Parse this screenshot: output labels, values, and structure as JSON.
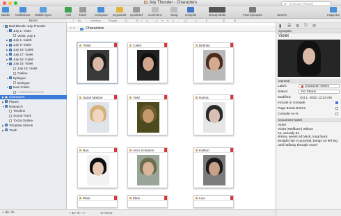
{
  "window": {
    "title": "July Thunder - Characters"
  },
  "toolbar": {
    "items": [
      {
        "label": "Binder",
        "color": "#4a8fd8"
      },
      {
        "label": "Collections",
        "color": "#4a8fd8"
      },
      {
        "label": "Mobile Sync",
        "color": "#5aa0e0"
      },
      {
        "label": "Add",
        "color": "#3fa34d"
      },
      {
        "label": "Trash",
        "color": "#9a9a9a"
      },
      {
        "label": "Compose",
        "color": "#4a8fd8"
      },
      {
        "label": "Keywords",
        "color": "#e1b23c"
      },
      {
        "label": "QuickRef",
        "color": "#9a9a9a"
      },
      {
        "label": "Comment",
        "color": "#bdbdbd"
      },
      {
        "label": "Wrap",
        "color": "#bdbdbd"
      },
      {
        "label": "Compile",
        "color": "#3f78c9"
      },
      {
        "label": "Group Mode",
        "color": "#555555"
      },
      {
        "label": "Find Synopsis",
        "color": "#7a7a7a"
      },
      {
        "label": "Search",
        "color": "#ffffff"
      },
      {
        "label": "Inspector",
        "color": "#4a8fd8"
      }
    ],
    "search_placeholder": "Q~ All (Exact Phrase)"
  },
  "format_bar": {
    "items": [
      "T",
      "¶a",
      "Helvetica",
      "Regular",
      "13",
      "B",
      "I",
      "U",
      "≡",
      "≡",
      "≡",
      "≡",
      "1.0",
      "A",
      "¶",
      "☰",
      "☰"
    ]
  },
  "binder": {
    "header": "Binder",
    "items": [
      {
        "label": "Bad Bloods: July Thunder",
        "indent": 0,
        "tri": "▼",
        "color": "#c9a24b"
      },
      {
        "label": "July 1: Violet",
        "indent": 1,
        "tri": "▼",
        "color": "#5b8fd0"
      },
      {
        "label": "Violet: July 1",
        "indent": 2,
        "tri": "",
        "color": "#ffffff"
      },
      {
        "label": "July 1: Caleb",
        "indent": 1,
        "tri": "▶",
        "color": "#5b8fd0"
      },
      {
        "label": "July 6: Violet",
        "indent": 1,
        "tri": "▶",
        "color": "#5b8fd0"
      },
      {
        "label": "July 16: Caleb",
        "indent": 1,
        "tri": "▶",
        "color": "#5b8fd0"
      },
      {
        "label": "July 17: Violet",
        "indent": 1,
        "tri": "▶",
        "color": "#5b8fd0"
      },
      {
        "label": "July 18: Caleb",
        "indent": 1,
        "tri": "▶",
        "color": "#5b8fd0"
      },
      {
        "label": "July 18: Violet",
        "indent": 1,
        "tri": "▼",
        "color": "#5b8fd0"
      },
      {
        "label": "July 18: Violet",
        "indent": 2,
        "tri": "",
        "color": "#ffffff"
      },
      {
        "label": "Outline",
        "indent": 2,
        "tri": "",
        "color": "#ffffff"
      },
      {
        "label": "Epilogue",
        "indent": 1,
        "tri": "▼",
        "color": "#5b8fd0"
      },
      {
        "label": "Epilogue",
        "indent": 2,
        "tri": "",
        "color": "#ffffff"
      },
      {
        "label": "New Folder",
        "indent": 1,
        "tri": "▼",
        "color": "#5b8fd0"
      },
      {
        "label": "Untitled Document",
        "indent": 2,
        "tri": "",
        "color": "#ffffff"
      },
      {
        "label": "Characters",
        "indent": 0,
        "tri": "▶",
        "color": "#ffffff",
        "selected": true
      },
      {
        "label": "Places",
        "indent": 0,
        "tri": "▶",
        "color": "#5b8fd0"
      },
      {
        "label": "Research",
        "indent": 0,
        "tri": "▼",
        "color": "#5b8fd0"
      },
      {
        "label": "Timeline",
        "indent": 1,
        "tri": "",
        "color": "#ffffff"
      },
      {
        "label": "Sound Track",
        "indent": 1,
        "tri": "",
        "color": "#ffffff"
      },
      {
        "label": "To-Do Outline",
        "indent": 1,
        "tri": "",
        "color": "#ffffff"
      },
      {
        "label": "Template Sheets",
        "indent": 0,
        "tri": "▶",
        "color": "#5b8fd0"
      },
      {
        "label": "Trash",
        "indent": 0,
        "tri": "▶",
        "color": "#9a9a9a"
      }
    ],
    "footer": "+  ⊞+  ⚙-"
  },
  "path": {
    "title": "Characters",
    "nav": "<  >"
  },
  "cards": [
    {
      "name": "Violet",
      "skin": "#d9b9a6",
      "hair": "#1c1c1c",
      "bg": "#3a3a3a",
      "selected": true
    },
    {
      "name": "Caleb",
      "skin": "#cfa68c",
      "hair": "#111111",
      "bg": "#222222"
    },
    {
      "name": "Brittney",
      "skin": "#d4aa8e",
      "hair": "#4a2b1e",
      "bg": "#b9b9b9"
    },
    {
      "name": "Sarah Malone",
      "skin": "#f0d6c0",
      "hair": "#d4b27a",
      "bg": "#dfe4ea"
    },
    {
      "name": "Yasir",
      "skin": "#c49a6c",
      "hair": "#6b5a2a",
      "bg": "#4d4a1e"
    },
    {
      "name": "Hanna",
      "skin": "#d8c0b4",
      "hair": "#2a2a2a",
      "bg": "#e6e6e6"
    },
    {
      "name": "Nao",
      "skin": "#e8c9b3",
      "hair": "#0f0f0f",
      "bg": "#f2f2f2"
    },
    {
      "name": "Ami Lochamce",
      "skin": "#d9b49a",
      "hair": "#6e6e4c",
      "bg": "#9aa59a"
    },
    {
      "name": "Kathun",
      "skin": "#c7a18a",
      "hair": "#1a1a1a",
      "bg": "#7b7b7b"
    },
    {
      "name": "Plato",
      "short": true
    },
    {
      "name": "Ellen",
      "short": true
    },
    {
      "name": "Levi",
      "short": true
    }
  ],
  "center_footer": {
    "icons": "+  ⊞+  ⚙-  □+",
    "count": "17 items"
  },
  "inspector": {
    "synopsis_label": "Synopsis",
    "doc_title": "Violet",
    "general_label": "General",
    "label_field": "Label:",
    "label_value": "Character Notes",
    "label_color": "#d9343a",
    "status_field": "Status:",
    "status_value": "No Status",
    "modified_field": "Modified:",
    "modified_value": "Oct 1, 2016, 12:23 AM",
    "include_compile": "Include in Compile",
    "page_break": "Page Break Before",
    "compile_as_is": "Compile As-Is",
    "doc_notes_label": "Document Notes",
    "notes": [
      "Violet",
      "Violet (Wellborn) Wilson",
      "14, actually 64",
      "skinny, wears all black, long black",
      "straight hair in ponytail, bangs on left leg",
      "until halfway through novel"
    ]
  }
}
